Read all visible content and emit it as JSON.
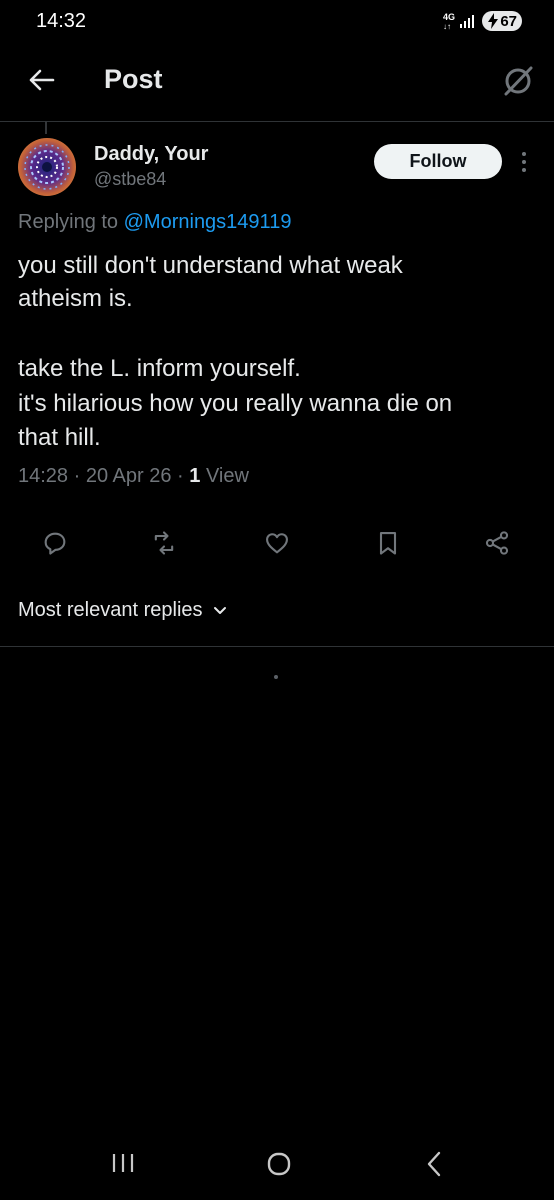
{
  "status_bar": {
    "time": "14:32",
    "network_type": "4G",
    "battery_level": "67",
    "icons": [
      "signal-icon",
      "battery-icon",
      "charging-icon"
    ]
  },
  "header": {
    "title": "Post",
    "back_icon": "arrow-left-icon",
    "grok_icon": "grok-icon"
  },
  "post": {
    "author_name": "Daddy, Your",
    "author_handle": "@stbe84",
    "follow_label": "Follow",
    "reply_prefix": "Replying to ",
    "reply_to_handle": "@Mornings149119",
    "lines": [
      "you still don't understand what weak",
      "atheism is.",
      "take the L. inform yourself.",
      "it's hilarious how you really wanna die on",
      "that hill."
    ],
    "time": "14:28",
    "date": "20 Apr 26",
    "views_count": "1",
    "views_label": "View",
    "separator": " · "
  },
  "actions": [
    "reply-icon",
    "repost-icon",
    "like-icon",
    "bookmark-icon",
    "share-icon"
  ],
  "replies_sort": {
    "label": "Most relevant replies",
    "icon": "chevron-down-icon"
  },
  "colors": {
    "background": "#000000",
    "text": "#e7e9ea",
    "muted": "#71767b",
    "link": "#1d9bf0",
    "divider": "#2f3336"
  }
}
